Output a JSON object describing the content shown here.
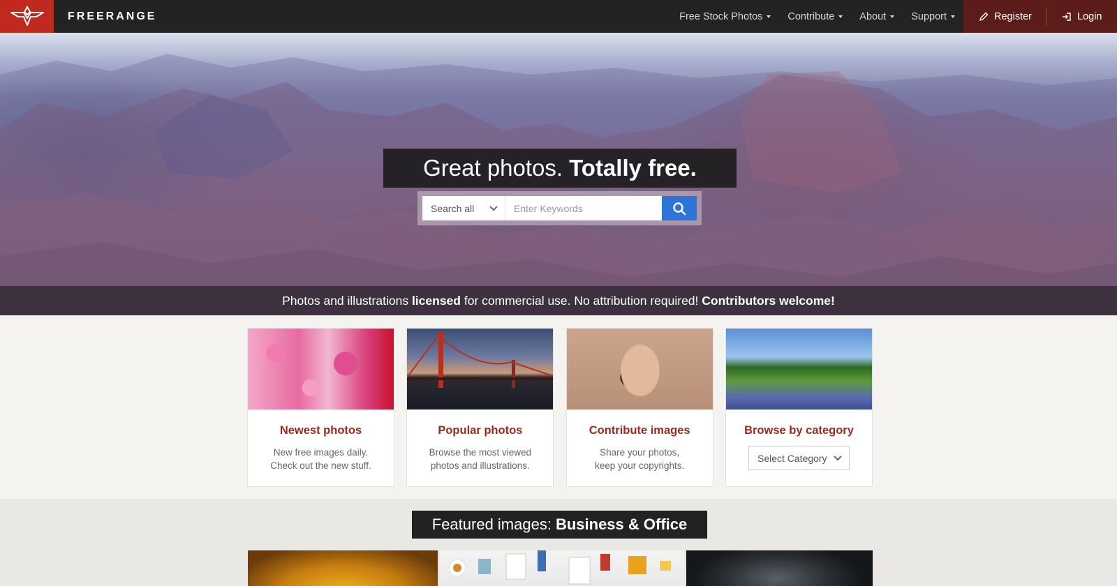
{
  "brand": {
    "name": "FREERANGE",
    "logo_color": "#c0291d"
  },
  "nav": {
    "items": [
      {
        "label": "Free Stock Photos"
      },
      {
        "label": "Contribute"
      },
      {
        "label": "About"
      },
      {
        "label": "Support"
      }
    ],
    "register_label": "Register",
    "login_label": "Login"
  },
  "hero": {
    "title_regular": "Great photos.",
    "title_bold": "Totally free.",
    "search": {
      "scope_selected": "Search all",
      "placeholder": "Enter Keywords",
      "value": ""
    },
    "tagline": {
      "part1": "Photos and illustrations ",
      "bold1": "licensed",
      "part2": " for commercial use. No attribution required! ",
      "bold2": "Contributors welcome!"
    }
  },
  "cards": [
    {
      "title": "Newest photos",
      "line1": "New free images daily.",
      "line2": "Check out the new stuff."
    },
    {
      "title": "Popular photos",
      "line1": "Browse the most viewed",
      "line2": "photos and illustrations."
    },
    {
      "title": "Contribute images",
      "line1": "Share your photos,",
      "line2": "keep your copyrights."
    },
    {
      "title": "Browse by category",
      "select_label": "Select Category"
    }
  ],
  "featured": {
    "prefix": "Featured images:",
    "category": "Business & Office"
  },
  "colors": {
    "navbar": "#232323",
    "auth_bg": "#5c1d1a",
    "card_title": "#9a2a1d",
    "search_button": "#2d74d9"
  }
}
